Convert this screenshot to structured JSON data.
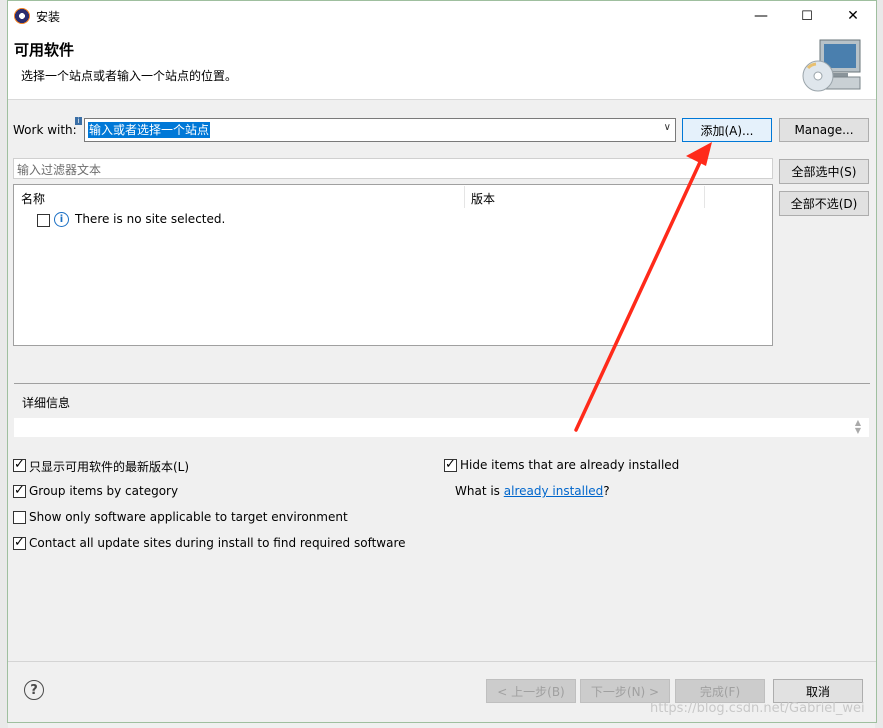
{
  "window": {
    "title": "安装",
    "controls": {
      "minimize": "—",
      "maximize": "☐",
      "close": "✕"
    }
  },
  "header": {
    "title": "可用软件",
    "description": "选择一个站点或者输入一个站点的位置。",
    "icon": "install-cd-monitor-icon"
  },
  "work_with": {
    "label": "Work with:",
    "value": "输入或者选择一个站点",
    "dropdown_icon": "chevron-down-icon"
  },
  "buttons": {
    "add": "添加(A)...",
    "manage": "Manage...",
    "select_all": "全部选中(S)",
    "deselect_all": "全部不选(D)"
  },
  "filter": {
    "placeholder": "输入过滤器文本"
  },
  "table": {
    "columns": [
      "名称",
      "版本"
    ],
    "rows": [
      {
        "checked": false,
        "icon": "info-icon",
        "text": "There is no site selected."
      }
    ]
  },
  "details": {
    "label": "详细信息"
  },
  "options": [
    {
      "label": "只显示可用软件的最新版本(L)",
      "checked": true
    },
    {
      "label": "Group items by category",
      "checked": true
    },
    {
      "label": "Show only software applicable to target environment",
      "checked": false
    },
    {
      "label": "Contact all update sites during install to find required software",
      "checked": true
    },
    {
      "label": "Hide items that are already installed",
      "checked": true
    }
  ],
  "installed": {
    "prefix": "What is ",
    "link": "already installed",
    "suffix": "?"
  },
  "footer": {
    "back": "< 上一步(B)",
    "next": "下一步(N) >",
    "finish": "完成(F)",
    "cancel": "取消"
  },
  "watermark": "https://blog.csdn.net/Gabriel_wei",
  "colors": {
    "accent": "#0078d7",
    "arrow": "#ff2a1a",
    "link": "#0066cc"
  }
}
